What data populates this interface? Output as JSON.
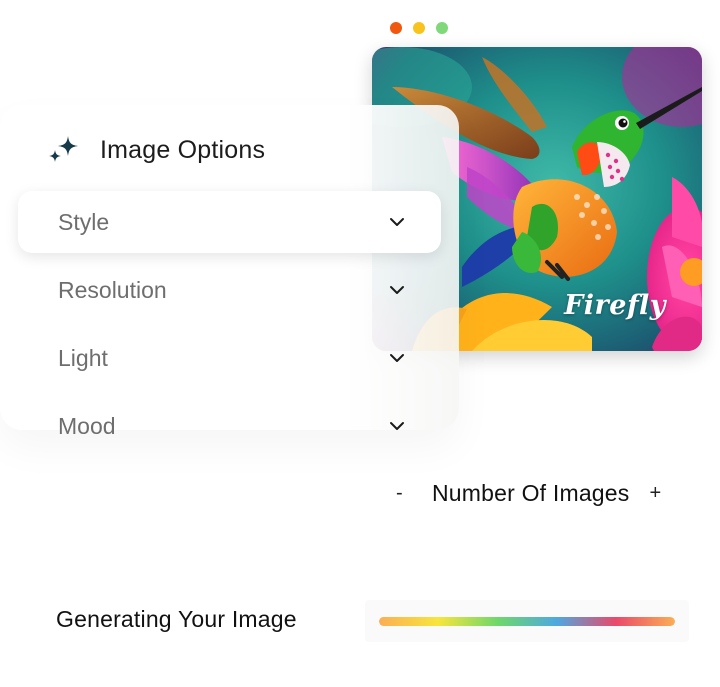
{
  "window_controls": {
    "colors": [
      "#f0570f",
      "#f8c31c",
      "#7fd97a"
    ],
    "icons": [
      "close-dot",
      "minimize-dot",
      "maximize-dot"
    ]
  },
  "preview": {
    "watermark": "Firefly",
    "subject": "hummingbird-image"
  },
  "panel": {
    "icon": "sparkle-icon",
    "title": "Image Options",
    "options": [
      {
        "label": "Style",
        "active": true
      },
      {
        "label": "Resolution",
        "active": false
      },
      {
        "label": "Light",
        "active": false
      },
      {
        "label": "Mood",
        "active": false
      }
    ]
  },
  "counter": {
    "decrement_label": "-",
    "label": "Number Of Images",
    "increment_label": "+"
  },
  "generation": {
    "label": "Generating Your Image",
    "progress": 1.0,
    "gradient": [
      "#fbae55",
      "#f7e53d",
      "#6fd86a",
      "#4ea8e0",
      "#ea4a6a",
      "#fbae55"
    ]
  }
}
